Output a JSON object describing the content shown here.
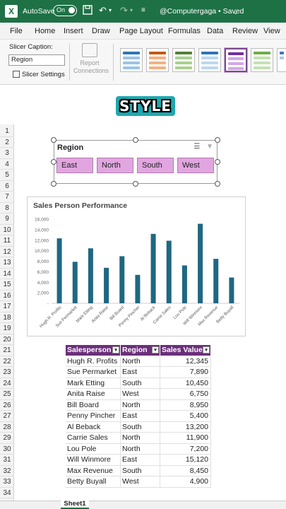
{
  "titlebar": {
    "app_icon": "X",
    "autosave_label": "AutoSave",
    "toggle_state": "On",
    "save_icon": "save-icon",
    "undo_icon": "undo-icon",
    "redo_icon": "redo-icon",
    "more_icon": "more-icon",
    "doc_title": "@Computergaga • Saved"
  },
  "menu": {
    "items": [
      "File",
      "Home",
      "Insert",
      "Draw",
      "Page Layout",
      "Formulas",
      "Data",
      "Review",
      "View"
    ]
  },
  "ribbon": {
    "slicer_caption_label": "Slicer Caption:",
    "slicer_caption_value": "Region",
    "slicer_settings_label": "Slicer Settings",
    "report_connections_label": "Report Connections"
  },
  "banner": {
    "text": "STYLE"
  },
  "row_numbers": [
    "1",
    "2",
    "3",
    "4",
    "5",
    "6",
    "7",
    "8",
    "9",
    "10",
    "11",
    "12",
    "13",
    "14",
    "15",
    "16",
    "17",
    "18",
    "19",
    "20",
    "21",
    "22",
    "23",
    "24",
    "25",
    "26",
    "27",
    "28",
    "29",
    "30",
    "31",
    "32",
    "33",
    "34"
  ],
  "slicer": {
    "title": "Region",
    "buttons": [
      "East",
      "North",
      "South",
      "West"
    ]
  },
  "chart_data": {
    "type": "bar",
    "title": "Sales Person Performance",
    "categories": [
      "Hugh R. Profits",
      "Sue Permarket",
      "Mark Etting",
      "Anita Raise",
      "Bill Board",
      "Penny Pincher",
      "Al Beback",
      "Carrie Sales",
      "Lou Pole",
      "Will Winmore",
      "Max Revenue",
      "Betty Buyall"
    ],
    "values": [
      12345,
      7890,
      10450,
      6750,
      8950,
      5400,
      13200,
      11900,
      7200,
      15120,
      8450,
      4900
    ],
    "y_ticks": [
      "-",
      "2,000",
      "4,000",
      "6,000",
      "8,000",
      "10,000",
      "12,000",
      "14,000",
      "16,000"
    ],
    "ylim": [
      0,
      16000
    ],
    "bar_color": "#1f6782",
    "grid": false
  },
  "table": {
    "headers": [
      "Salesperson",
      "Region",
      "Sales Value"
    ],
    "rows": [
      [
        "Hugh R. Profits",
        "North",
        "12,345"
      ],
      [
        "Sue Permarket",
        "East",
        "7,890"
      ],
      [
        "Mark Etting",
        "South",
        "10,450"
      ],
      [
        "Anita Raise",
        "West",
        "6,750"
      ],
      [
        "Bill Board",
        "North",
        "8,950"
      ],
      [
        "Penny Pincher",
        "East",
        "5,400"
      ],
      [
        "Al Beback",
        "South",
        "13,200"
      ],
      [
        "Carrie Sales",
        "North",
        "11,900"
      ],
      [
        "Lou Pole",
        "North",
        "7,200"
      ],
      [
        "Will Winmore",
        "East",
        "15,120"
      ],
      [
        "Max Revenue",
        "South",
        "8,450"
      ],
      [
        "Betty Buyall",
        "West",
        "4,900"
      ]
    ]
  },
  "sheet_tab": "Sheet1",
  "colors": {
    "excel_green": "#1e7145",
    "table_header": "#6b2f7a",
    "slicer_button": "#e1a6e0"
  }
}
